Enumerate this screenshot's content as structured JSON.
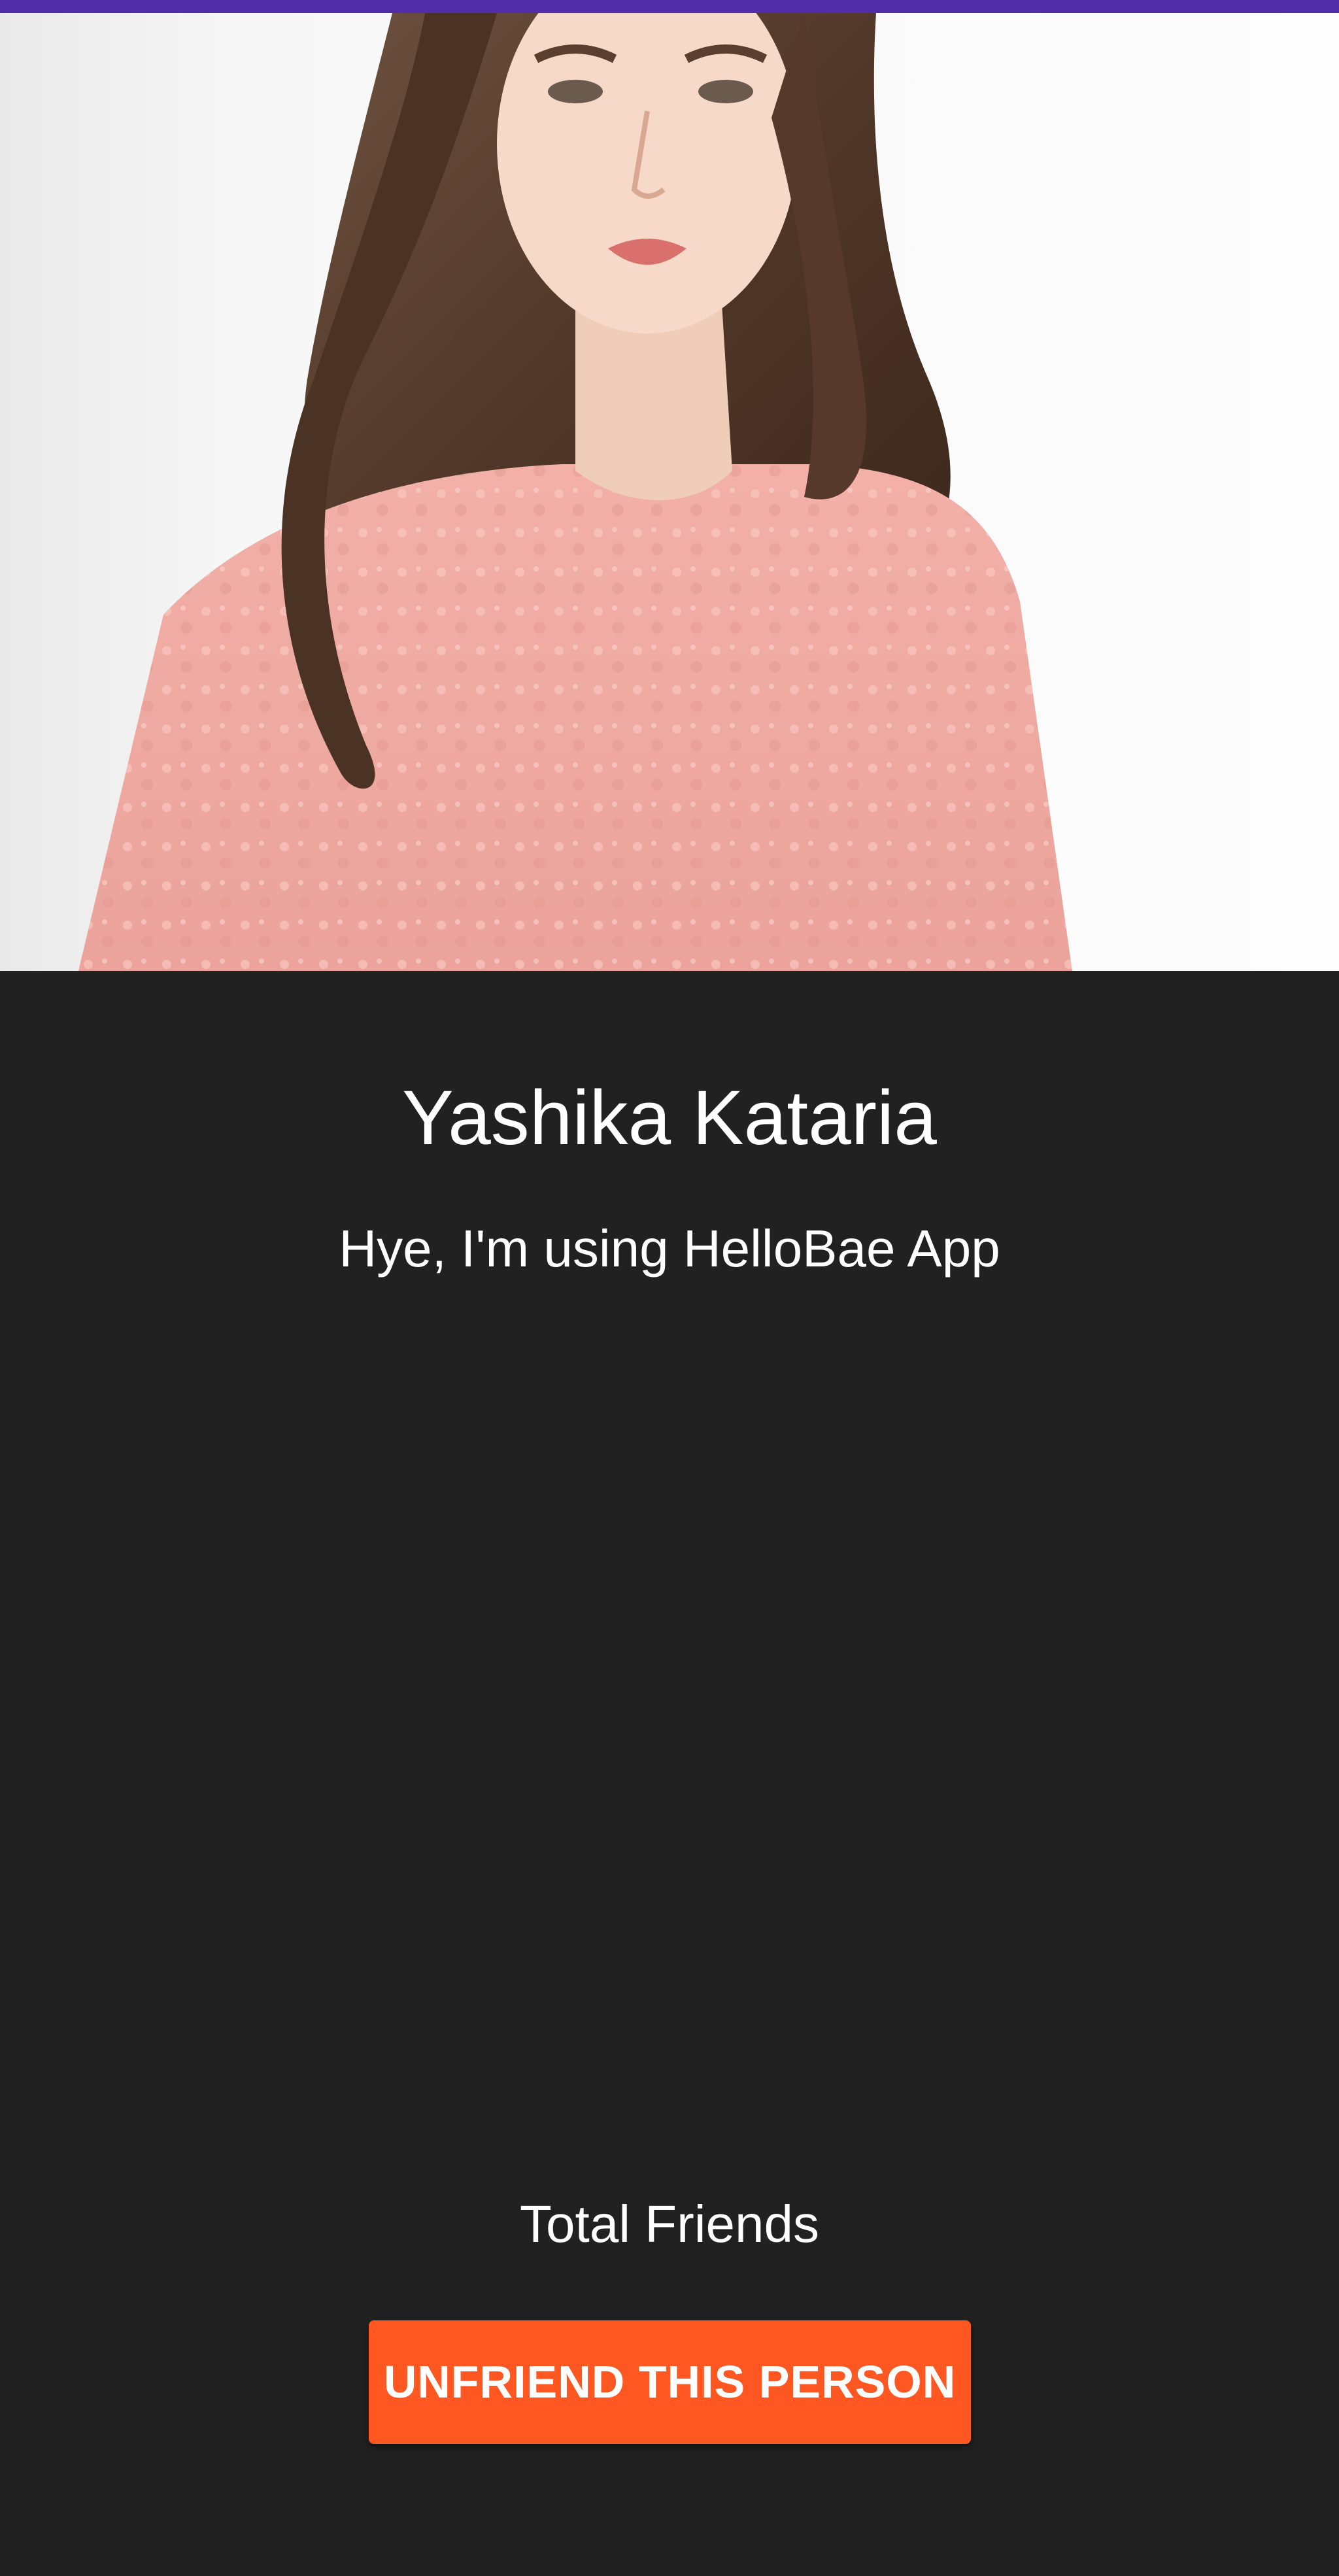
{
  "theme": {
    "status_bar_color": "#512DA8",
    "background_color": "#212121",
    "button_color": "#FF5722",
    "text_color": "#FFFFFF"
  },
  "profile": {
    "photo_icon": "profile-photo",
    "name": "Yashika Kataria",
    "status": "Hye, I'm using HelloBae App",
    "total_friends_label": "Total Friends"
  },
  "actions": {
    "unfriend_label": "UNFRIEND THIS PERSON"
  }
}
